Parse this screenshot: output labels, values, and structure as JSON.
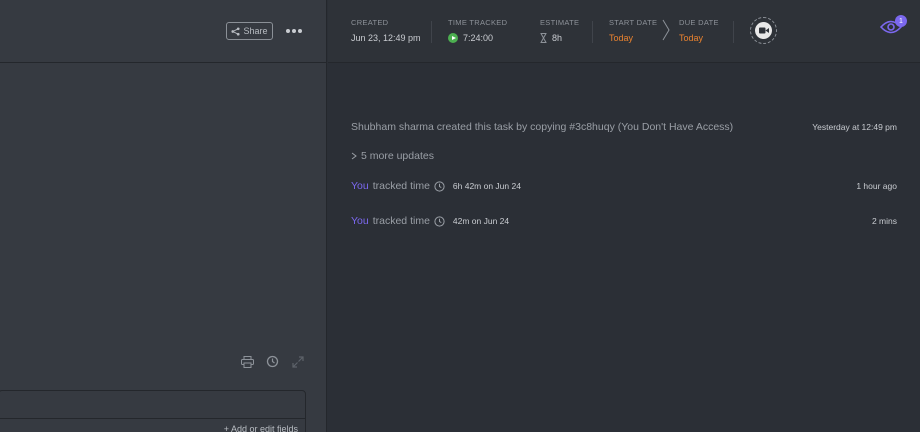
{
  "left_panel": {
    "share_label": "Share",
    "more_icon": "ellipsis-icon",
    "tools": [
      "print-icon",
      "history-icon",
      "expand-icon"
    ],
    "add_fields_label": "+ Add or edit fields"
  },
  "header": {
    "created": {
      "label": "CREATED",
      "value": "Jun 23, 12:49 pm"
    },
    "time_tracked": {
      "label": "TIME TRACKED",
      "value": "7:24:00"
    },
    "estimate": {
      "label": "ESTIMATE",
      "value": "8h"
    },
    "start_date": {
      "label": "START DATE",
      "value": "Today"
    },
    "due_date": {
      "label": "DUE DATE",
      "value": "Today"
    },
    "watchers_count": "1",
    "colors": {
      "accent": "#7b68ee",
      "date": "#e9822f",
      "play": "#4caf50"
    }
  },
  "activity": {
    "created_text": "Shubham sharma created this task by copying #3c8huqy (You Don't Have Access)",
    "created_time": "Yesterday at 12:49 pm",
    "more_updates": "5 more updates",
    "entries": [
      {
        "who": "You",
        "action": "tracked time",
        "detail": "6h 42m on Jun 24",
        "time": "1 hour ago"
      },
      {
        "who": "You",
        "action": "tracked time",
        "detail": "42m on Jun 24",
        "time": "2 mins"
      }
    ]
  }
}
